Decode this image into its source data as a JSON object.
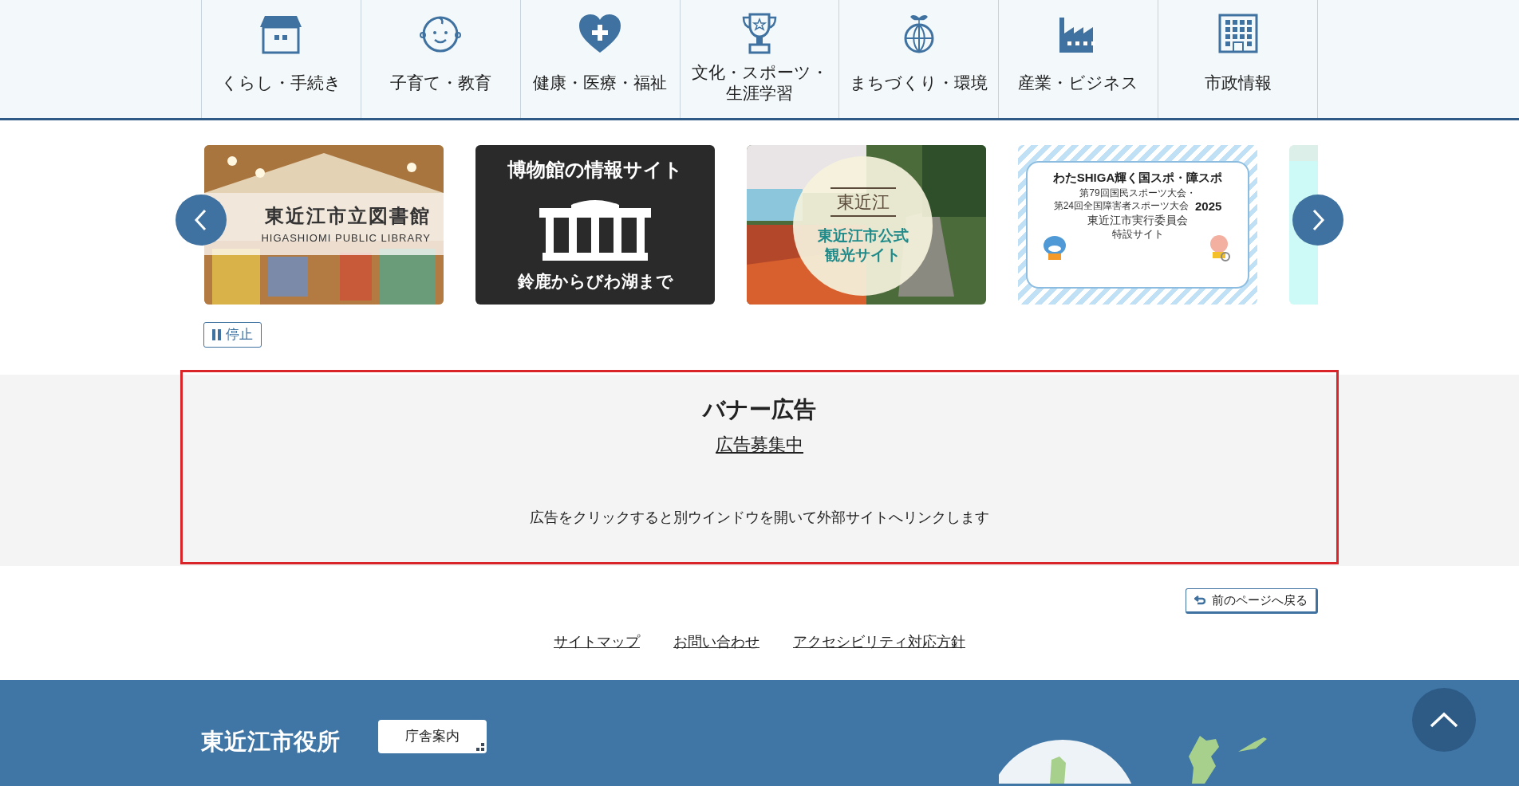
{
  "categories": [
    {
      "label": "くらし・手続き",
      "kind": "house"
    },
    {
      "label": "子育て・教育",
      "kind": "baby"
    },
    {
      "label": "健康・医療・福祉",
      "kind": "heart"
    },
    {
      "label": "文化・スポーツ・生涯学習",
      "kind": "trophy"
    },
    {
      "label": "まちづくり・環境",
      "kind": "globe"
    },
    {
      "label": "産業・ビジネス",
      "kind": "factory"
    },
    {
      "label": "市政情報",
      "kind": "building"
    }
  ],
  "carousel": {
    "banners": [
      {
        "kind": "library",
        "texts": [
          "東近江市立図書館",
          "HIGASHIOMI PUBLIC LIBRARY"
        ]
      },
      {
        "kind": "museum",
        "texts": [
          "博物館の情報サイト",
          "鈴鹿からびわ湖まで"
        ]
      },
      {
        "kind": "tourism",
        "texts": [
          "東近江",
          "東近江市公式",
          "観光サイト"
        ]
      },
      {
        "kind": "sports",
        "texts": [
          "わたSHIGA輝く国スポ・障スポ",
          "第79回国民スポーツ大会・",
          "第24回全国障害者スポーツ大会",
          "2025",
          "東近江市実行委員会",
          "特設サイト"
        ]
      },
      {
        "kind": "partial"
      }
    ],
    "stop_button": "停止"
  },
  "ad_section": {
    "title": "バナー広告",
    "link": "広告募集中",
    "note": "広告をクリックすると別ウインドウを開いて外部サイトへリンクします"
  },
  "back_button": "前のページへ戻る",
  "footer_links": [
    "サイトマップ",
    "お問い合わせ",
    "アクセシビリティ対応方針"
  ],
  "footer": {
    "org_name": "東近江市役所",
    "guide_button": "庁舎案内"
  }
}
